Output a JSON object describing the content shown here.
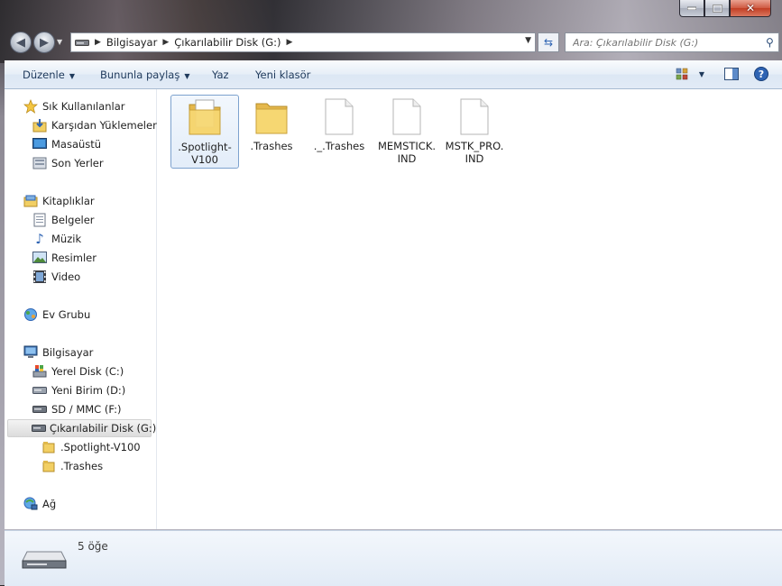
{
  "window": {
    "caption_buttons": [
      "minimize",
      "maximize",
      "close"
    ]
  },
  "navigation": {
    "back_icon": "back-arrow-icon",
    "forward_icon": "forward-arrow-icon",
    "breadcrumb": [
      "Bilgisayar",
      "Çıkarılabilir Disk (G:)"
    ],
    "search_placeholder": "Ara: Çıkarılabilir Disk (G:)"
  },
  "toolbar": {
    "organize": "Düzenle",
    "share": "Bununla paylaş",
    "burn": "Yaz",
    "new_folder": "Yeni klasör",
    "view_icon": "view-options-icon",
    "preview_icon": "preview-pane-icon",
    "help_icon": "help-icon"
  },
  "sidebar": {
    "favorites": {
      "label": "Sık Kullanılanlar",
      "items": [
        "Karşıdan Yüklemeler",
        "Masaüstü",
        "Son Yerler"
      ]
    },
    "libraries": {
      "label": "Kitaplıklar",
      "items": [
        "Belgeler",
        "Müzik",
        "Resimler",
        "Video"
      ]
    },
    "homegroup": {
      "label": "Ev Grubu"
    },
    "computer": {
      "label": "Bilgisayar",
      "items": [
        "Yerel Disk (C:)",
        "Yeni Birim (D:)",
        "SD / MMC (F:)",
        "Çıkarılabilir Disk (G:)"
      ],
      "selected": "Çıkarılabilir Disk (G:)",
      "subfolders": [
        ".Spotlight-V100",
        ".Trashes"
      ]
    },
    "network": {
      "label": "Ağ"
    }
  },
  "files": [
    {
      "line1": ".Spotlight-",
      "line2": "V100",
      "kind": "folder-with-file",
      "selected": true
    },
    {
      "line1": ".Trashes",
      "line2": "",
      "kind": "folder",
      "selected": false
    },
    {
      "line1": "._.Trashes",
      "line2": "",
      "kind": "file",
      "selected": false
    },
    {
      "line1": "MEMSTICK.",
      "line2": "IND",
      "kind": "file",
      "selected": false
    },
    {
      "line1": "MSTK_PRO.",
      "line2": "IND",
      "kind": "file",
      "selected": false
    }
  ],
  "details": {
    "count": "5 öğe"
  },
  "colors": {
    "toolbar_text": "#1e395b",
    "selection_border": "#7da2ce",
    "folder_yellow": "#f2cf63"
  }
}
